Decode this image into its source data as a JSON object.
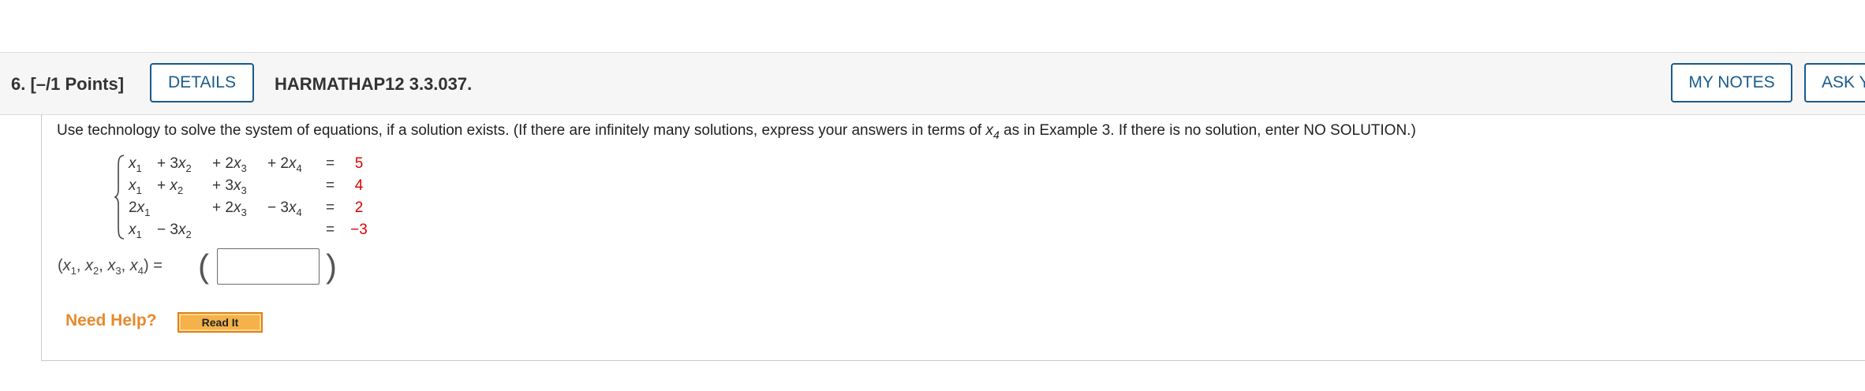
{
  "header": {
    "question_number": "6.",
    "points": "[–/1 Points]",
    "details_label": "DETAILS",
    "question_code": "HARMATHAP12 3.3.037.",
    "my_notes_label": "MY NOTES",
    "ask_label": "ASK Y"
  },
  "prompt": {
    "before": "Use technology to solve the system of equations, if a solution exists. (If there are infinitely many solutions, express your answers in terms of ",
    "var": "x",
    "sub": "4",
    "after": " as in Example 3. If there is no solution, enter NO SOLUTION.)"
  },
  "system": {
    "rows": [
      {
        "c1": "x",
        "s1": "1",
        "c2": "+ 3x",
        "s2": "2",
        "c3": "+ 2x",
        "s3": "3",
        "c4": "+ 2x",
        "s4": "4",
        "eq": "=",
        "rhs": "5"
      },
      {
        "c1": "x",
        "s1": "1",
        "c2": "+   x",
        "s2": "2",
        "c3": "+ 3x",
        "s3": "3",
        "c4": "",
        "s4": "",
        "eq": "=",
        "rhs": "4"
      },
      {
        "c1": "2x",
        "s1": "1",
        "c2": "",
        "s2": "",
        "c3": "+ 2x",
        "s3": "3",
        "c4": "− 3x",
        "s4": "4",
        "eq": "=",
        "rhs": "2"
      },
      {
        "c1": "x",
        "s1": "1",
        "c2": "− 3x",
        "s2": "2",
        "c3": "",
        "s3": "",
        "c4": "",
        "s4": "",
        "eq": "=",
        "rhs": "−3"
      }
    ]
  },
  "answer": {
    "lhs_open": "(",
    "vars": [
      {
        "v": "x",
        "s": "1"
      },
      {
        "v": "x",
        "s": "2"
      },
      {
        "v": "x",
        "s": "3"
      },
      {
        "v": "x",
        "s": "4"
      }
    ],
    "sep": ", ",
    "lhs_close": ") =",
    "value": ""
  },
  "help": {
    "label": "Need Help?",
    "read_it_label": "Read It"
  }
}
